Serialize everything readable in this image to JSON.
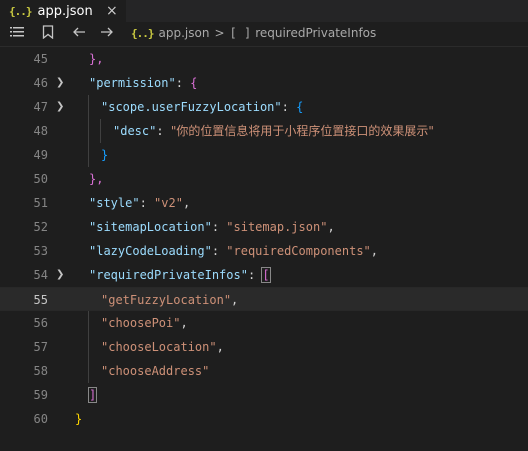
{
  "tab": {
    "icon": "json-icon",
    "glyph": "{..}",
    "filename": "app.json",
    "close": "×"
  },
  "toolbar": {
    "list_icon": "☰",
    "bookmark_icon": "🔖",
    "back_icon": "←",
    "forward_icon": "→"
  },
  "breadcrumb": {
    "glyph": "{..}",
    "file": "app.json",
    "separator": ">",
    "array_glyph": "[ ]",
    "symbol": "requiredPrivateInfos"
  },
  "editor": {
    "current_line": "55",
    "lines": [
      {
        "num": "45",
        "text": "},"
      },
      {
        "num": "46",
        "key": "\"permission\"",
        "colon": ": ",
        "open": "{"
      },
      {
        "num": "47",
        "key": "\"scope.userFuzzyLocation\"",
        "colon": ": ",
        "open": "{"
      },
      {
        "num": "48",
        "key": "\"desc\"",
        "colon": ": ",
        "value": "\"你的位置信息将用于小程序位置接口的效果展示\""
      },
      {
        "num": "49",
        "text": "}"
      },
      {
        "num": "50",
        "text": "},"
      },
      {
        "num": "51",
        "key": "\"style\"",
        "colon": ": ",
        "value": "\"v2\"",
        "comma": ","
      },
      {
        "num": "52",
        "key": "\"sitemapLocation\"",
        "colon": ": ",
        "value": "\"sitemap.json\"",
        "comma": ","
      },
      {
        "num": "53",
        "key": "\"lazyCodeLoading\"",
        "colon": ": ",
        "value": "\"requiredComponents\"",
        "comma": ","
      },
      {
        "num": "54",
        "key": "\"requiredPrivateInfos\"",
        "colon": ": ",
        "open": "["
      },
      {
        "num": "55",
        "value": "\"getFuzzyLocation\"",
        "comma": ","
      },
      {
        "num": "56",
        "value": "\"choosePoi\"",
        "comma": ","
      },
      {
        "num": "57",
        "value": "\"chooseLocation\"",
        "comma": ","
      },
      {
        "num": "58",
        "value": "\"chooseAddress\""
      },
      {
        "num": "59",
        "text": "]"
      },
      {
        "num": "60",
        "text": "}"
      }
    ]
  },
  "colors": {
    "background": "#1e1e1e",
    "key": "#9cdcfe",
    "string": "#ce9178",
    "bracket_level1": "#da70d6",
    "bracket_level2": "#179fff",
    "bracket_level0": "#ffd700",
    "json_icon": "#cbcb41"
  }
}
